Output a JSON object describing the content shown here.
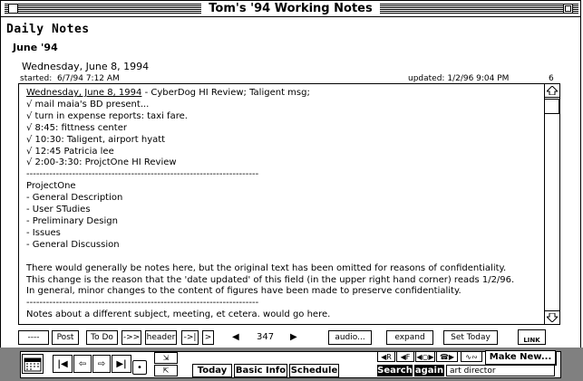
{
  "window": {
    "title": "Tom's '94 Working Notes"
  },
  "header": {
    "section_title": "Daily Notes",
    "month": "June '94",
    "date": "Wednesday, June 8, 1994",
    "started_label": "started:",
    "started_value": "6/7/94 7:12 AM",
    "updated_label": "updated:",
    "updated_value": "1/2/96 9:04 PM",
    "page_number": "6"
  },
  "note": {
    "first_line_date": "Wednesday, June 8, 1994",
    "first_line_rest": " - CyberDog HI Review; Taligent msg;",
    "lines": [
      "√ mail maia's BD present...",
      "√ turn in expense reports: taxi fare.",
      "√ 8:45: fittness center",
      "√ 10:30: Taligent, airport hyatt",
      "√ 12:45 Patricia lee",
      "√ 2:00-3:30: ProjctOne HI Review",
      "-----------------------------------------------------------------------",
      "ProjectOne",
      "- General Description",
      "- User STudies",
      "- Preliminary Design",
      "- Issues",
      "- General Discussion",
      "",
      "There would generally be notes here, but the original text has been omitted for reasons of confidentiality.",
      "This change is the reason that the 'date updated' of this field (in the upper right hand corner) reads 1/2/96.",
      "In general, minor changes to the content of figures have been made to preserve confidentiality.",
      "-----------------------------------------------------------------------",
      "Notes about a different subject, meeting, et cetera. would go here."
    ]
  },
  "toolbar": {
    "dashes": "----",
    "post": "Post",
    "todo": "To Do",
    "arrow_right": "->>",
    "header": "header",
    "arrow_bar": "->|",
    "gt": ">",
    "prev": "◀",
    "record_number": "347",
    "next": "▶",
    "audio": "audio...",
    "expand": "expand",
    "set_today": "Set Today",
    "link": "LINK"
  },
  "bottom": {
    "today": "Today",
    "basic_info": "Basic Info",
    "schedule": "Schedule",
    "make_new": "Make New...",
    "search": "Search",
    "again": "again",
    "search_value": "art director"
  }
}
